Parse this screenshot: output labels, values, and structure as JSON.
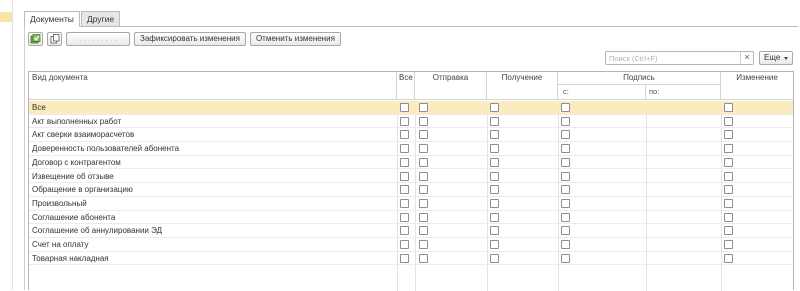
{
  "tabs": [
    {
      "label": "Документы",
      "active": true
    },
    {
      "label": "Другие",
      "active": false
    }
  ],
  "toolbar": {
    "icon1": "check-save-icon",
    "icon2": "copy-icon",
    "disabled_label": ". . . . . . . . .",
    "fix_label": "Зафиксировать изменения",
    "cancel_label": "Отменить изменения"
  },
  "search": {
    "placeholder": "Поиск (Ctrl+F)",
    "clear": "×",
    "more_label": "Еще"
  },
  "table": {
    "headers": {
      "doc_type": "Вид документа",
      "all": "Все",
      "send": "Отправка",
      "receive": "Получение",
      "sign": "Подпись",
      "sign_from": "с:",
      "sign_to": "по:",
      "change": "Изменение"
    },
    "rows": [
      {
        "name": "Все",
        "selected": true
      },
      {
        "name": "Акт выполненных работ",
        "selected": false
      },
      {
        "name": "Акт сверки взаиморасчетов",
        "selected": false
      },
      {
        "name": "Доверенность пользователей абонента",
        "selected": false
      },
      {
        "name": "Договор с контрагентом",
        "selected": false
      },
      {
        "name": "Извещение об отзыве",
        "selected": false
      },
      {
        "name": "Обращение в организацию",
        "selected": false
      },
      {
        "name": "Произвольный",
        "selected": false
      },
      {
        "name": "Соглашение абонента",
        "selected": false
      },
      {
        "name": "Соглашение об аннулировании ЭД",
        "selected": false
      },
      {
        "name": "Счет на оплату",
        "selected": false
      },
      {
        "name": "Товарная накладная",
        "selected": false
      }
    ]
  },
  "colors": {
    "selected_row": "#f9ecbe",
    "border": "#b5b5b5"
  }
}
